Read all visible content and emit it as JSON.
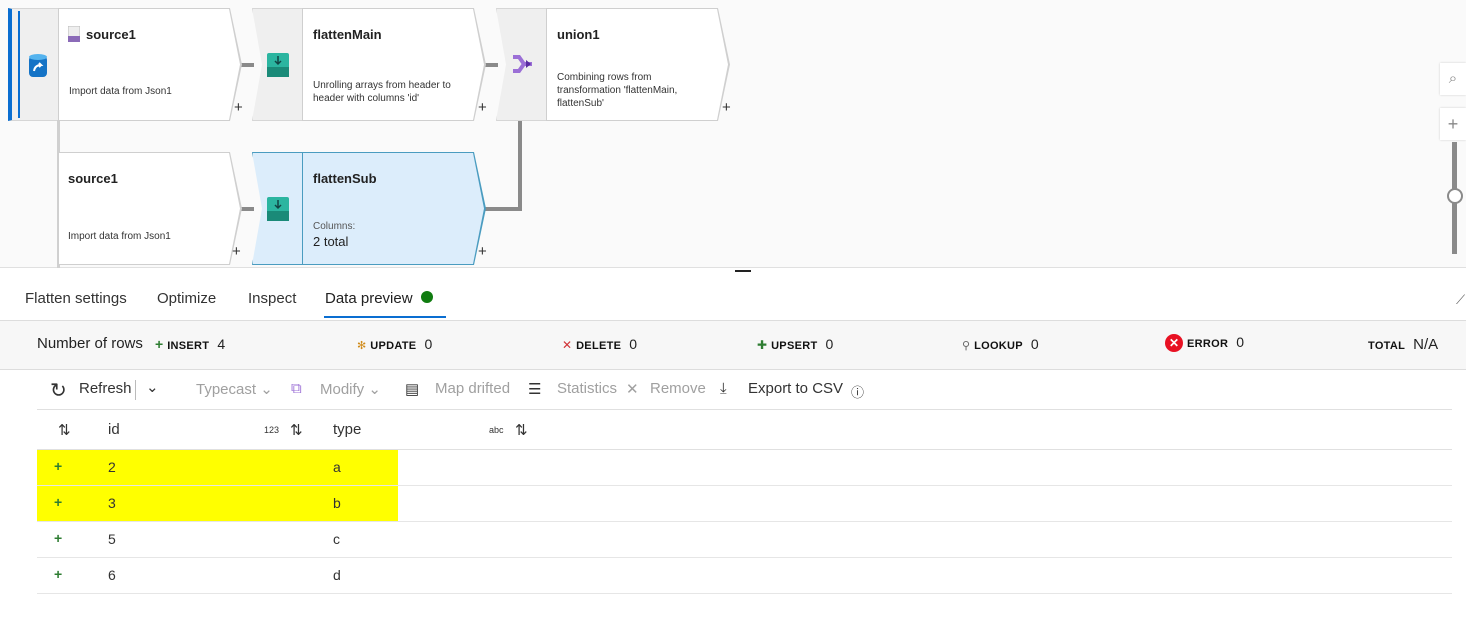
{
  "canvas": {
    "nodes": [
      {
        "title": "source1",
        "desc": "Import data from Json1",
        "icon": "json-file-icon"
      },
      {
        "title": "flattenMain",
        "desc": "Unrolling arrays from header to header with columns 'id'",
        "icon": "flatten-icon"
      },
      {
        "title": "union1",
        "desc": "Combining rows from transformation 'flattenMain, flattenSub'",
        "icon": "union-icon"
      },
      {
        "title": "source1",
        "desc": "Import data from Json1"
      },
      {
        "title": "flattenSub",
        "desc": "Columns:",
        "columns": "2 total",
        "icon": "flatten-icon",
        "selected": true
      }
    ],
    "add": "+",
    "zoom": {
      "search": "⌕",
      "plus": "+"
    }
  },
  "tabs": [
    {
      "label": "Flatten settings"
    },
    {
      "label": "Optimize"
    },
    {
      "label": "Inspect"
    },
    {
      "label": "Data preview",
      "active": true,
      "status_color": "#107c10"
    }
  ],
  "rows": {
    "label": "Number of rows",
    "stats": [
      {
        "label": "INSERT",
        "value": "4",
        "icon": "insert-icon",
        "color": "#2e7d32"
      },
      {
        "label": "UPDATE",
        "value": "0",
        "icon": "update-icon",
        "color": "#d08a18"
      },
      {
        "label": "DELETE",
        "value": "0",
        "icon": "delete-icon",
        "color": "#d13438"
      },
      {
        "label": "UPSERT",
        "value": "0",
        "icon": "upsert-icon",
        "color": "#2e7d32"
      },
      {
        "label": "LOOKUP",
        "value": "0",
        "icon": "lookup-icon"
      },
      {
        "label": "ERROR",
        "value": "0",
        "icon": "error-icon",
        "color": "#e81123"
      },
      {
        "label": "TOTAL",
        "value": "N/A"
      }
    ]
  },
  "toolbar": {
    "refresh": "Refresh",
    "typecast": "Typecast",
    "modify": "Modify",
    "map_drifted": "Map drifted",
    "statistics": "Statistics",
    "remove": "Remove",
    "export": "Export to CSV"
  },
  "table": {
    "columns": [
      {
        "name": "id",
        "type": "123"
      },
      {
        "name": "type",
        "type": "abc"
      }
    ],
    "rows": [
      {
        "id": "2",
        "type": "a",
        "highlight": true
      },
      {
        "id": "3",
        "type": "b",
        "highlight": true
      },
      {
        "id": "5",
        "type": "c"
      },
      {
        "id": "6",
        "type": "d"
      }
    ],
    "highlight_color": "#ffff00"
  }
}
